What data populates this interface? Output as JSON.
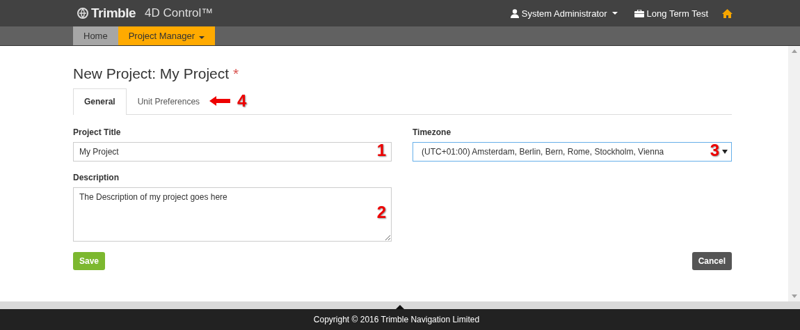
{
  "header": {
    "brand": "Trimble",
    "product": "4D Control™",
    "user": "System Administrator",
    "project": "Long Term Test"
  },
  "nav": [
    {
      "label": "Home",
      "selected": false,
      "dropdown": false
    },
    {
      "label": "Project Manager",
      "selected": true,
      "dropdown": true
    }
  ],
  "page": {
    "title": "New Project: My Project",
    "required_mark": "*"
  },
  "tabs": [
    {
      "label": "General",
      "selected": true
    },
    {
      "label": "Unit Preferences",
      "selected": false
    }
  ],
  "tab_annotation": "4",
  "form": {
    "project_title": {
      "label": "Project Title",
      "value": "My Project",
      "annotation": "1"
    },
    "timezone": {
      "label": "Timezone",
      "value": "(UTC+01:00) Amsterdam, Berlin, Bern, Rome, Stockholm, Vienna",
      "annotation": "3"
    },
    "description": {
      "label": "Description",
      "value": "The Description of my project goes here",
      "annotation": "2"
    }
  },
  "buttons": {
    "save": "Save",
    "cancel": "Cancel"
  },
  "footer": "Copyright © 2016 Trimble Navigation Limited"
}
